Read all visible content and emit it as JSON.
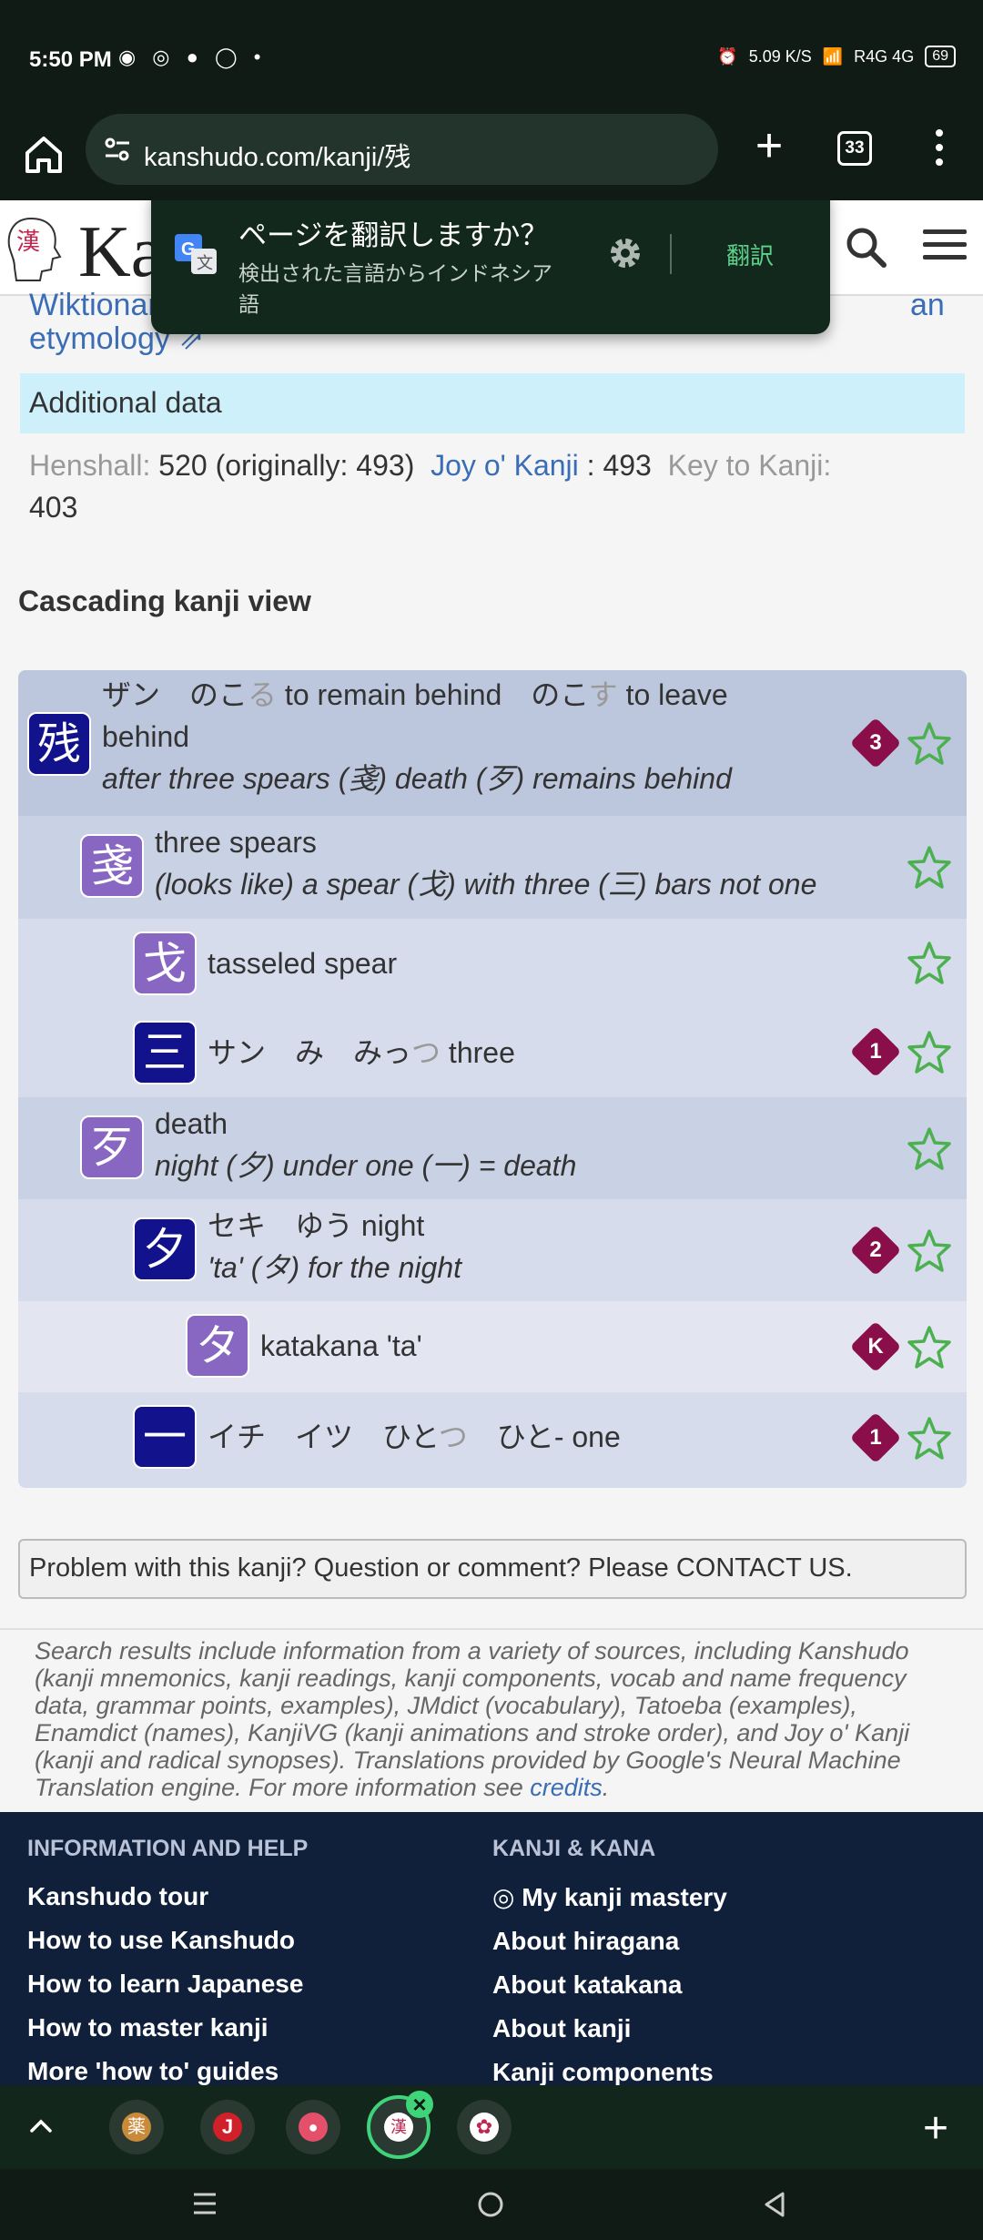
{
  "status_bar": {
    "time": "5:50 PM",
    "notif_icons": "◉ ◎ ● ◯ •",
    "speed": "5.09 K/S",
    "network": "R4G 4G",
    "battery": "69"
  },
  "browser": {
    "url": "kanshudo.com/kanji/残",
    "tab_count": "33"
  },
  "site": {
    "logo_glyph": "漢",
    "logo_text": "Ka"
  },
  "translate_popup": {
    "title": "ページを翻訳しますか？",
    "subtitle": "検出された言語からインドネシア語",
    "translate_label": "翻訳"
  },
  "etymology": {
    "partial_text": "Wiktionary",
    "partial_right": "an",
    "label": "etymology ⇗"
  },
  "additional": {
    "section_title": "Additional data",
    "henshall_label": "Henshall:",
    "henshall_value": "520 (originally: 493)",
    "joy_label": "Joy o' Kanji",
    "joy_value": ": 493",
    "key_label": "Key to Kanji:",
    "key_value": "403"
  },
  "cascade": {
    "title": "Cascading kanji view",
    "rows": [
      {
        "kanji": "残",
        "line1a": "ザン　のこ",
        "okuri1": "る",
        "line1b": " to remain behind　のこ",
        "okuri2": "す",
        "line1c": " to leave",
        "line2": "behind",
        "line3": "after three spears (戔) death (歹) remains behind",
        "badge": "3"
      },
      {
        "kanji": "戔",
        "line1": "three spears",
        "line2": "(looks like) a spear (戈) with three (三) bars not one"
      },
      {
        "kanji": "戈",
        "line1": "tasseled spear"
      },
      {
        "kanji": "三",
        "line1a": "サン　み　みっ",
        "okuri1": "つ",
        "line1b": " three",
        "badge": "1"
      },
      {
        "kanji": "歹",
        "line1": "death",
        "line2": "night (夕) under one (一) = death"
      },
      {
        "kanji": "夕",
        "line1": "セキ　ゆう night",
        "line2": "'ta' (タ) for the night",
        "badge": "2"
      },
      {
        "kanji": "タ",
        "line1": "katakana 'ta'",
        "badge": "K"
      },
      {
        "kanji": "一",
        "line1a": "イチ　イツ　ひと",
        "okuri1": "つ",
        "line1b": "　ひと- one",
        "badge": "1"
      }
    ]
  },
  "problem": "Problem with this kanji? Question or comment? Please CONTACT US.",
  "footnote": {
    "text": "Search results include information from a variety of sources, including Kanshudo (kanji mnemonics, kanji readings, kanji components, vocab and name frequency data, grammar points, examples), JMdict (vocabulary), Tatoeba (examples), Enamdict (names), KanjiVG (kanji animations and stroke order), and Joy o' Kanji (kanji and radical synopses). Translations provided by Google's Neural Machine Translation engine. For more information see ",
    "link": "credits",
    "end": "."
  },
  "footer": {
    "col1_title": "INFORMATION AND HELP",
    "col1_links": [
      "Kanshudo tour",
      "How to use Kanshudo",
      "How to learn Japanese",
      "How to master kanji",
      "More 'how to' guides"
    ],
    "col2_title": "KANJI & KANA",
    "col2_links": [
      "◎ My kanji mastery",
      "About hiragana",
      "About katakana",
      "About kanji",
      "Kanji components"
    ]
  },
  "tab_strip": {
    "favicons": [
      "薬",
      "J",
      "●",
      "漢",
      "✿"
    ]
  },
  "colors": {
    "accent_green": "#3fd47a",
    "link_blue": "#3a6db5",
    "kanji_blue": "#11128c",
    "kanji_purple": "#8867c2",
    "badge_maroon": "#8a0e4a"
  }
}
